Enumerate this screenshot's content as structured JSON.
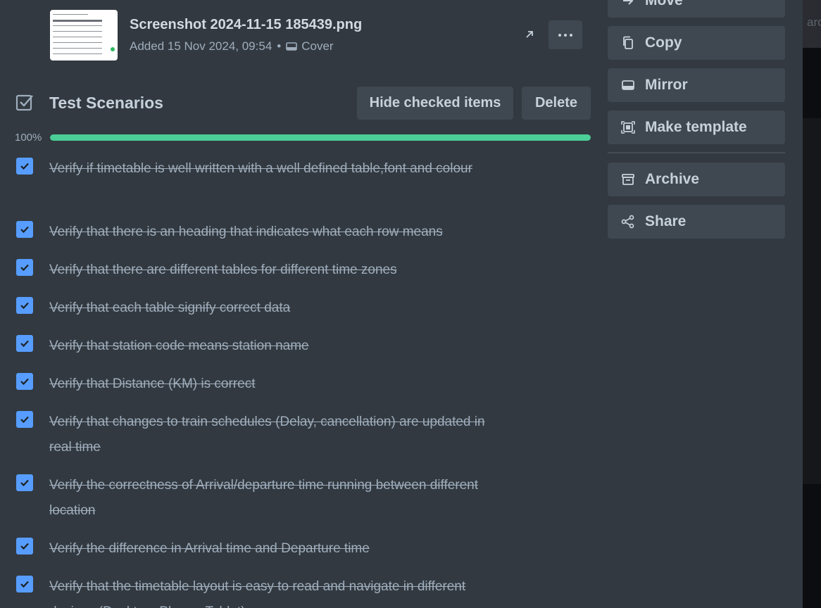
{
  "board": {
    "partial_title": "arc"
  },
  "attachment": {
    "name": "Screenshot 2024-11-15 185439.png",
    "added": "Added 15 Nov 2024, 09:54",
    "separator": "•",
    "cover_label": "Cover",
    "open_icon": "arrow-up-right-icon",
    "more_icon": "more-icon"
  },
  "checklist": {
    "title": "Test Scenarios",
    "hide_checked_label": "Hide checked items",
    "delete_label": "Delete",
    "progress_label": "100%",
    "progress": 1.0,
    "progress_color": "#4bce97",
    "checkbox_color": "#579dff",
    "items": [
      {
        "text": "Verify if timetable is well written with a well defined table,font and colour",
        "checked": true
      },
      {
        "text": "Verify that there is an heading that indicates what each row means",
        "checked": true
      },
      {
        "text": "Verify that there are different tables for different time zones",
        "checked": true
      },
      {
        "text": "Verify that each table signify correct data",
        "checked": true
      },
      {
        "text": "Verify that station code means station name",
        "checked": true
      },
      {
        "text": "Verify that Distance (KM) is correct",
        "checked": true
      },
      {
        "text": "Verify that changes to train schedules (Delay, cancellation) are updated in real time",
        "checked": true
      },
      {
        "text": "Verify the correctness of Arrival/departure time running between different location",
        "checked": true
      },
      {
        "text": "Verify the difference in Arrival time and Departure time",
        "checked": true
      },
      {
        "text": "Verify that the timetable layout is easy to read and navigate in different devices (Desktop, Phone, Tablet)",
        "checked": true
      }
    ]
  },
  "sidebar": {
    "move_label": "Move",
    "copy_label": "Copy",
    "mirror_label": "Mirror",
    "make_template_label": "Make template",
    "archive_label": "Archive",
    "share_label": "Share"
  }
}
